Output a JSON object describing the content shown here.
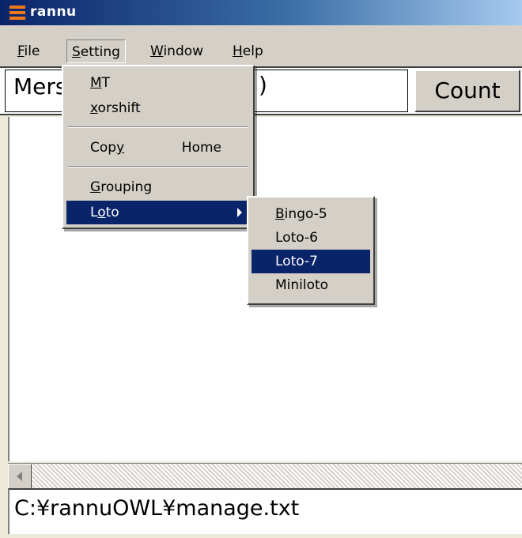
{
  "window": {
    "title": "rannu"
  },
  "menubar": {
    "items": [
      "File",
      "Setting",
      "Window",
      "Help"
    ],
    "mnemonics": [
      "F",
      "S",
      "W",
      "H"
    ]
  },
  "toolbar": {
    "combo_value": "Mers",
    "combo_value_tail": ")",
    "count_label": "Count"
  },
  "setting_menu": {
    "items": [
      {
        "label": "MT",
        "mnemonic_index": 0
      },
      {
        "label": "xorshift",
        "mnemonic_index": 0
      },
      {
        "label": "Copy",
        "shortcut": "Home",
        "mnemonic_index": 3
      },
      {
        "label": "Grouping",
        "mnemonic_index": 0
      },
      {
        "label": "Loto",
        "mnemonic_index": 1,
        "has_submenu": true,
        "highlighted": true
      }
    ]
  },
  "loto_submenu": {
    "items": [
      {
        "label": "Bingo-5"
      },
      {
        "label": "Loto-6"
      },
      {
        "label": "Loto-7",
        "highlighted": true
      },
      {
        "label": "Miniloto"
      }
    ]
  },
  "status": {
    "path": "C:¥rannuOWL¥manage.txt"
  },
  "colors": {
    "highlight": "#0a246a",
    "menu_bg": "#d4d0c8",
    "title_gradient_start": "#0a246a"
  }
}
